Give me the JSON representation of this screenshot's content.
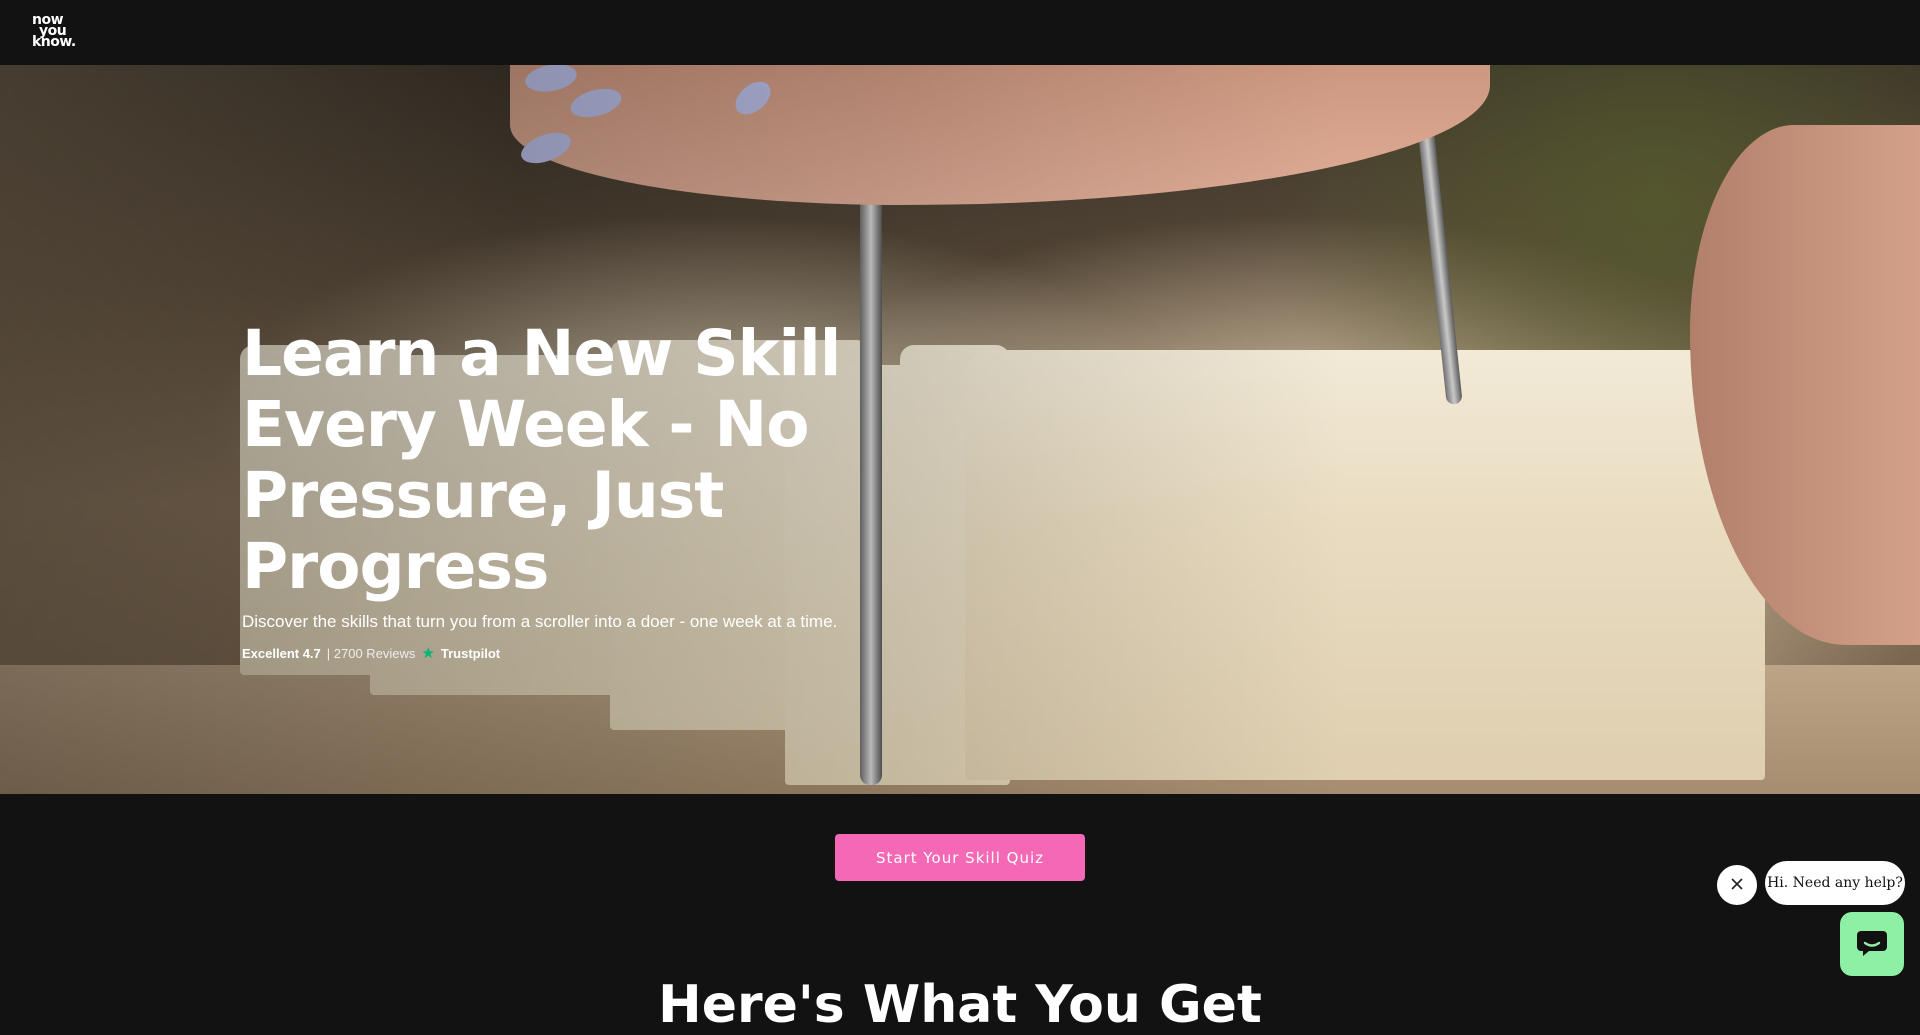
{
  "header": {
    "logo_line1": "now",
    "logo_line2": "you",
    "logo_line3": "know."
  },
  "hero": {
    "title": "Learn a New Skill Every Week - No Pressure, Just Progress",
    "subtitle": "Discover the skills that turn you from a scroller into a doer - one week at a time.",
    "rating_label": "Excellent 4.7",
    "reviews": "| 2700 Reviews",
    "trustpilot": "Trustpilot"
  },
  "cta": {
    "label": "Start Your Skill Quiz",
    "color": "#f468b5"
  },
  "next_section": {
    "heading_partial": "Here's What You Get"
  },
  "chat": {
    "prompt": "Hi. Need any help?",
    "launcher_color": "#8ef0a4"
  },
  "icons": {
    "star": "star-icon",
    "close": "close-icon",
    "chat": "chat-icon"
  }
}
